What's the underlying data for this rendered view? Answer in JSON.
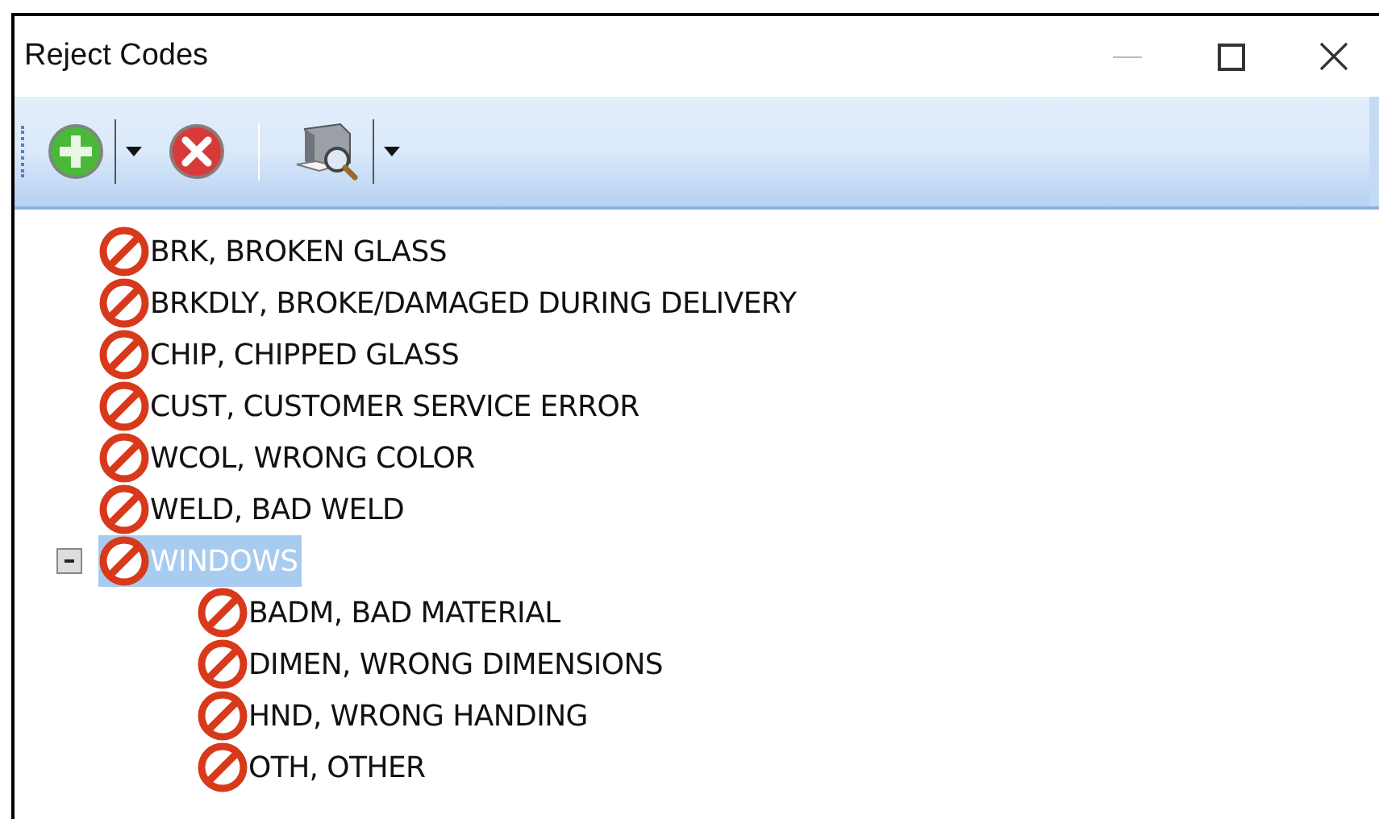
{
  "window": {
    "title": "Reject Codes"
  },
  "toolbar": {
    "buttons": [
      {
        "kind": "add",
        "dropdown": true
      },
      {
        "kind": "delete",
        "dropdown": false
      },
      {
        "kind": "print-preview",
        "dropdown": true
      }
    ]
  },
  "tree": {
    "items": [
      {
        "label": "BRK, BROKEN GLASS",
        "selected": false
      },
      {
        "label": "BRKDLY, BROKE/DAMAGED DURING DELIVERY",
        "selected": false
      },
      {
        "label": "CHIP, CHIPPED GLASS",
        "selected": false
      },
      {
        "label": "CUST, CUSTOMER SERVICE ERROR",
        "selected": false
      },
      {
        "label": "WCOL, WRONG COLOR",
        "selected": false
      },
      {
        "label": "WELD, BAD WELD",
        "selected": false
      },
      {
        "label": "WINDOWS",
        "selected": true,
        "expanded": true,
        "children": [
          {
            "label": "BADM, BAD MATERIAL",
            "selected": false
          },
          {
            "label": "DIMEN, WRONG DIMENSIONS",
            "selected": false
          },
          {
            "label": "HND, WRONG HANDING",
            "selected": false
          },
          {
            "label": "OTH, OTHER",
            "selected": false
          }
        ]
      }
    ]
  }
}
